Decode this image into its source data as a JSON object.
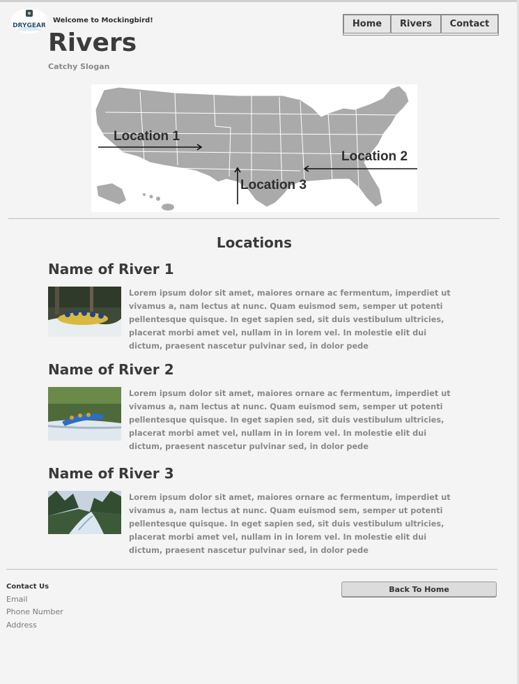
{
  "header": {
    "logo_text": "DRYGEAR",
    "welcome": "Welcome to Mockingbird!",
    "title": "Rivers",
    "slogan": "Catchy Slogan"
  },
  "nav": {
    "items": [
      "Home",
      "Rivers",
      "Contact"
    ]
  },
  "map": {
    "labels": [
      "Location 1",
      "Location 2",
      "Location 3"
    ]
  },
  "locations": {
    "heading": "Locations",
    "rivers": [
      {
        "name": "Name of River 1",
        "text": "Lorem ipsum dolor sit amet, maiores ornare ac fermentum, imperdiet ut vivamus a, nam lectus at nunc. Quam euismod sem, semper ut potenti pellentesque quisque. In eget sapien sed, sit duis vestibulum ultricies, placerat morbi amet vel, nullam in in lorem vel. In molestie elit dui dictum, praesent nascetur pulvinar sed, in dolor pede"
      },
      {
        "name": "Name of River 2",
        "text": "Lorem ipsum dolor sit amet, maiores ornare ac fermentum, imperdiet ut vivamus a, nam lectus at nunc. Quam euismod sem, semper ut potenti pellentesque quisque. In eget sapien sed, sit duis vestibulum ultricies, placerat morbi amet vel, nullam in in lorem vel. In molestie elit dui dictum, praesent nascetur pulvinar sed, in dolor pede"
      },
      {
        "name": "Name of River 3",
        "text": "Lorem ipsum dolor sit amet, maiores ornare ac fermentum, imperdiet ut vivamus a, nam lectus at nunc. Quam euismod sem, semper ut potenti pellentesque quisque. In eget sapien sed, sit duis vestibulum ultricies, placerat morbi amet vel, nullam in in lorem vel. In molestie elit dui dictum, praesent nascetur pulvinar sed, in dolor pede"
      }
    ]
  },
  "footer": {
    "contact_title": "Contact Us",
    "email": "Email",
    "phone": "Phone Number",
    "address": "Address",
    "back_button": "Back To Home"
  },
  "colors": {
    "background": "#f4f4f4",
    "map_fill": "#aaaaaa",
    "button_fill": "#e6e6e6"
  }
}
